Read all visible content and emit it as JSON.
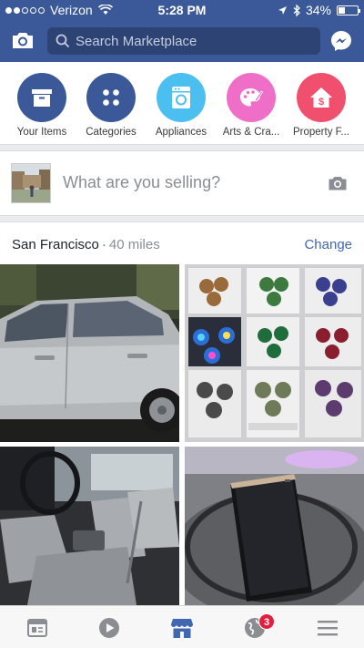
{
  "status_bar": {
    "carrier": "Verizon",
    "time": "5:28 PM",
    "battery": "34%",
    "battery_level": 0.34
  },
  "header": {
    "search_placeholder": "Search Marketplace",
    "icons": [
      "camera-icon",
      "search-icon",
      "messenger-icon"
    ]
  },
  "categories": [
    {
      "label": "Your Items",
      "icon": "box-icon",
      "color": "#3b5998"
    },
    {
      "label": "Categories",
      "icon": "grid-dots-icon",
      "color": "#3b5998"
    },
    {
      "label": "Appliances",
      "icon": "washer-icon",
      "color": "#4bc0f0"
    },
    {
      "label": "Arts & Cra...",
      "icon": "palette-icon",
      "color": "#ef6ec8"
    },
    {
      "label": "Property F...",
      "icon": "house-dollar-icon",
      "color": "#f0506e"
    }
  ],
  "composer": {
    "prompt": "What are you selling?"
  },
  "location": {
    "city": "San Francisco",
    "separator": "·",
    "distance": "40 miles",
    "change_label": "Change"
  },
  "listings": [
    {
      "name": "silver-car"
    },
    {
      "name": "fidget-spinners"
    },
    {
      "name": "truck-interior"
    },
    {
      "name": "samsung-phone"
    }
  ],
  "tabbar": {
    "tabs": [
      "news-feed-icon",
      "video-icon",
      "marketplace-icon",
      "notifications-globe-icon",
      "menu-icon"
    ],
    "active": "marketplace-icon",
    "notification_count": "3"
  },
  "colors": {
    "brand_blue": "#3b5998",
    "link_blue": "#4267b2",
    "badge_red": "#e41e3f"
  }
}
